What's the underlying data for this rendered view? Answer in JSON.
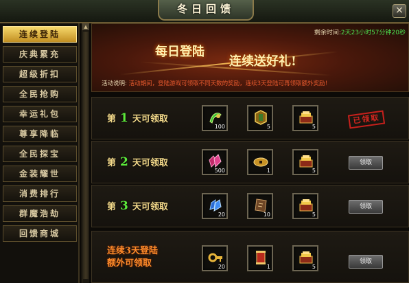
{
  "window": {
    "title": "冬日回馈",
    "close_label": "×"
  },
  "sidebar": {
    "items": [
      {
        "label": "连续登陆",
        "active": true
      },
      {
        "label": "庆典累充"
      },
      {
        "label": "超级折扣"
      },
      {
        "label": "全民抢购"
      },
      {
        "label": "幸运礼包"
      },
      {
        "label": "尊享降临"
      },
      {
        "label": "全民探宝"
      },
      {
        "label": "金装耀世"
      },
      {
        "label": "消费排行"
      },
      {
        "label": "群魔浩劫"
      },
      {
        "label": "回馈商城"
      }
    ]
  },
  "banner": {
    "time_label": "剩余时间:",
    "time_value": "2天23小时57分钟20秒",
    "headline1": "每日登陆",
    "headline2": "连续送好礼!",
    "desc_label": "活动说明:",
    "desc_text": "活动期间，登陆游戏可领取不同天数的奖励，连续3天登陆可再领取额外奖励！"
  },
  "rows": [
    {
      "prefix": "第",
      "day": "1",
      "suffix": "天可领取",
      "items": [
        {
          "icon": "green-scroll-icon",
          "count": "100"
        },
        {
          "icon": "gold-medallion-icon",
          "count": "5"
        },
        {
          "icon": "gold-chest-icon",
          "count": "5"
        }
      ],
      "status": "已领取"
    },
    {
      "prefix": "第",
      "day": "2",
      "suffix": "天可领取",
      "items": [
        {
          "icon": "pink-crystal-icon",
          "count": "500"
        },
        {
          "icon": "gold-coin-icon",
          "count": "1"
        },
        {
          "icon": "gold-chest-icon",
          "count": "5"
        }
      ],
      "button": "领取"
    },
    {
      "prefix": "第",
      "day": "3",
      "suffix": "天可领取",
      "items": [
        {
          "icon": "blue-crystal-icon",
          "count": "20"
        },
        {
          "icon": "bronze-book-icon",
          "count": "10"
        },
        {
          "icon": "gold-chest-icon",
          "count": "5"
        }
      ],
      "button": "领取"
    },
    {
      "line1": "连续3天登陆",
      "line2": "额外可领取",
      "items": [
        {
          "icon": "gold-key-icon",
          "count": "20"
        },
        {
          "icon": "red-scroll-icon",
          "count": "1"
        },
        {
          "icon": "gold-chest-icon",
          "count": "5"
        }
      ],
      "button": "领取"
    }
  ]
}
